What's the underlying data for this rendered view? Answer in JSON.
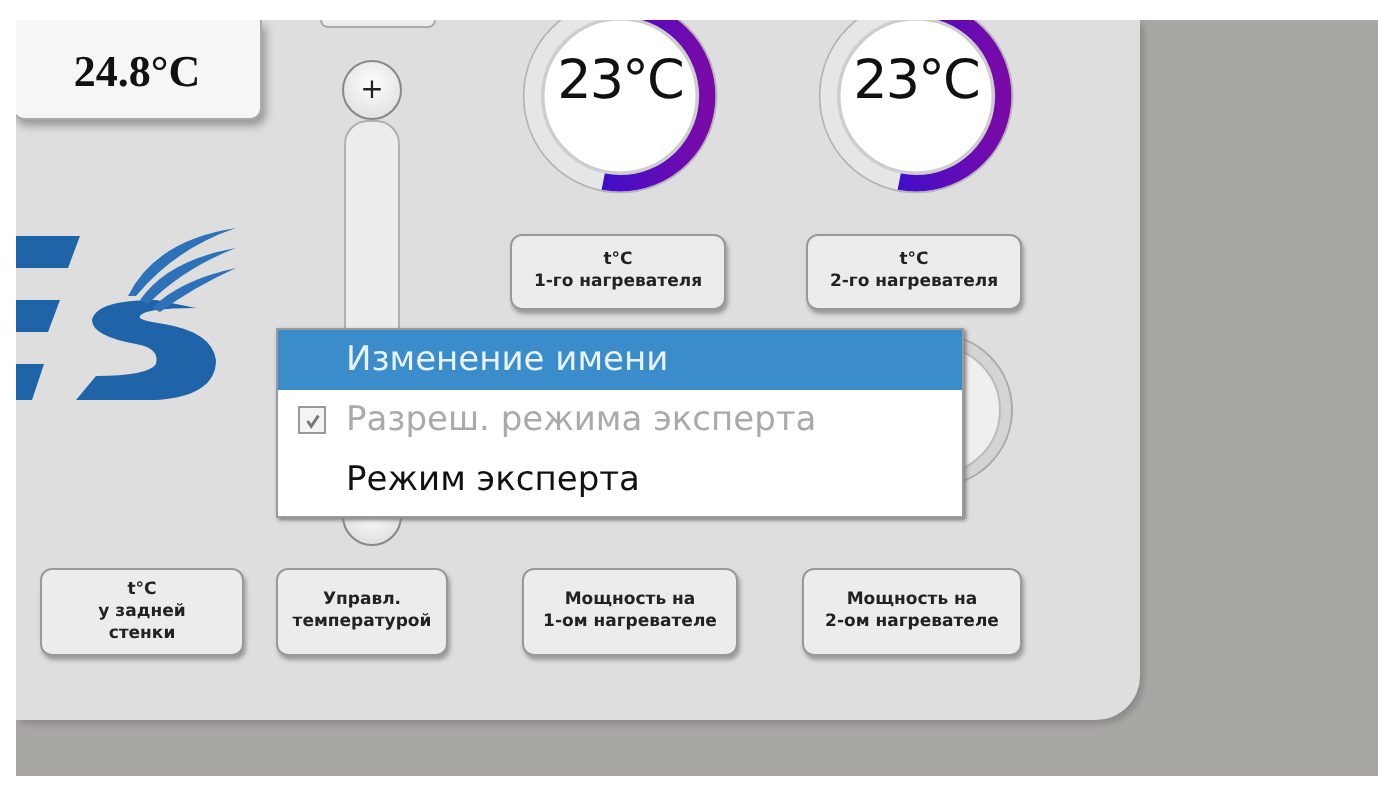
{
  "temperature_display": {
    "value": "24.8°C"
  },
  "slider": {
    "plus_label": "+"
  },
  "gauges": [
    {
      "reading": "23°C",
      "level": 0.53,
      "label": "t°C\n1-го нагревателя"
    },
    {
      "reading": "23°C",
      "level": 0.53,
      "label": "t°C\n2-го нагревателя"
    }
  ],
  "buttons": [
    "t°C\nу задней\nстенки",
    "Управл.\nтемпературой",
    "Мощность на\n1-ом нагревателе",
    "Мощность на\n2-ом нагревателе"
  ],
  "context_menu": [
    {
      "label": "Изменение имени",
      "kind": "action",
      "selected": true,
      "disabled": false
    },
    {
      "label": "Разреш. режима эксперта",
      "kind": "check",
      "checked": true,
      "selected": false,
      "disabled": true
    },
    {
      "label": "Режим эксперта",
      "kind": "action",
      "selected": false,
      "disabled": false
    }
  ]
}
